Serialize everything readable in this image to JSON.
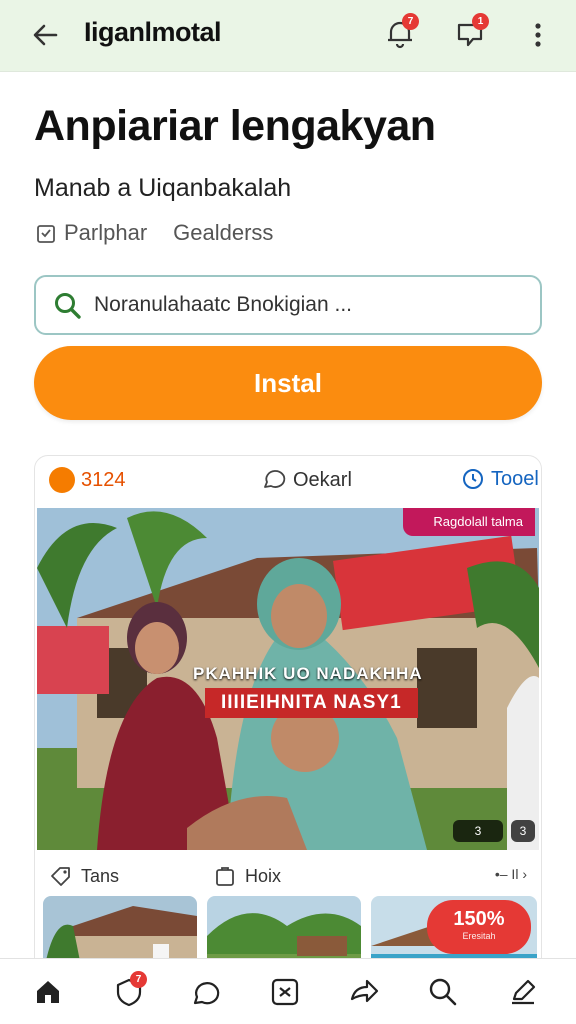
{
  "topbar": {
    "title": "Iiganlmotal",
    "notif_badge": "7",
    "chat_badge": "1"
  },
  "main": {
    "headline": "Anpiariar lengakyan",
    "subtitle": "Manab a Uiqanbakalah",
    "meta_left": "Parlphar",
    "meta_right": "Gealderss",
    "search_placeholder": "Noranulahaatc Bnokigian ...",
    "install_label": "Instal"
  },
  "card": {
    "count": "3124",
    "comment_label": "Oekarl",
    "tool_label": "Tooel",
    "hero_tag": "Ragdolall talma",
    "overlay_line1": "PKAHHIK UO NADAKHHA",
    "overlay_line2": "IIIIEIHNITA NASY1",
    "chip1": "3",
    "chip2": "3",
    "foot_left": "Tans",
    "foot_mid": "Hoix",
    "foot_right": "•– Il",
    "promo_main": "150%",
    "promo_sub": "Eresitah"
  },
  "bottomnav": {
    "badge": "7",
    "items": [
      "home-icon",
      "shield-icon",
      "chat-icon",
      "scan-icon",
      "share-icon",
      "search-icon",
      "edit-icon"
    ]
  },
  "colors": {
    "accent_orange": "#fb8c0f",
    "topbar_bg": "#eaf5e6",
    "badge_red": "#e53935",
    "search_border": "#9cc6c4",
    "hero_tag": "#c2185b"
  }
}
